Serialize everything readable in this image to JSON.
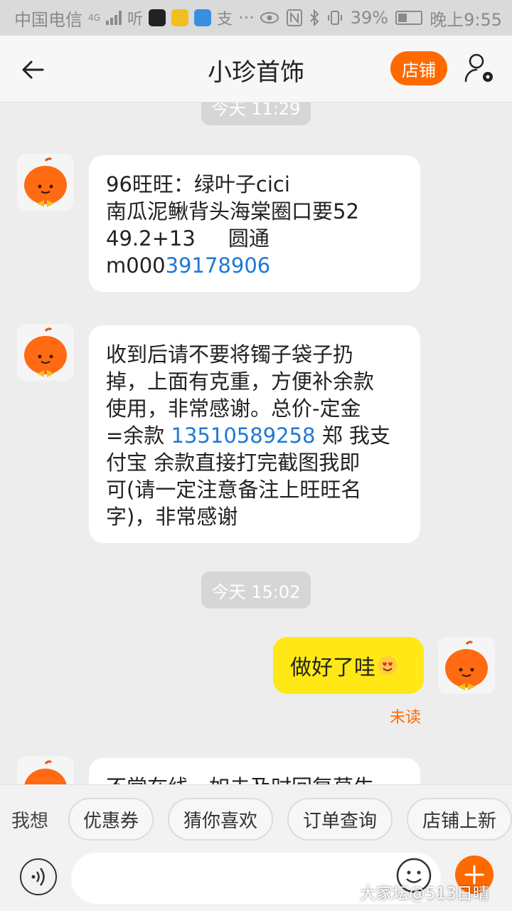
{
  "status_bar": {
    "carrier": "中国电信",
    "network": "4G",
    "battery": "39%",
    "time": "晚上9:55"
  },
  "header": {
    "title": "小珍首饰",
    "shop_button": "店铺"
  },
  "chat": {
    "time_1": "今天  11:29",
    "msg_1_lines": [
      "96旺旺：绿叶子cici",
      "南瓜泥鳅背头海棠圈口要52",
      "49.2+13     圆通"
    ],
    "msg_1_tracking_prefix": "m000",
    "msg_1_tracking_link": "39178906",
    "msg_2_lines": [
      "收到后请不要将镯子袋子扔",
      "掉，上面有克重，方便补余款",
      "使用，非常感谢。总价-定金"
    ],
    "msg_2_line4_prefix": "=余款 ",
    "msg_2_phone": "13510589258",
    "msg_2_line4_suffix": " 郑 我支",
    "msg_2_lines_end": [
      "付宝 余款直接打完截图我即",
      "可(请一定注意备注上旺旺名",
      "字)，非常感谢"
    ],
    "time_2": "今天  15:02",
    "msg_3": "做好了哇",
    "msg_3_status": "未读",
    "msg_4_partial": "不常在线，如未及时回复莫生"
  },
  "quick_bar": {
    "label": "我想",
    "chips": [
      "优惠券",
      "猜你喜欢",
      "订单查询",
      "店铺上新"
    ]
  },
  "input": {
    "placeholder": ""
  },
  "watermark": "大家坛@513日晴",
  "colors": {
    "accent": "#ff6a00",
    "self_bubble": "#ffe816",
    "link": "#1e78d6"
  }
}
